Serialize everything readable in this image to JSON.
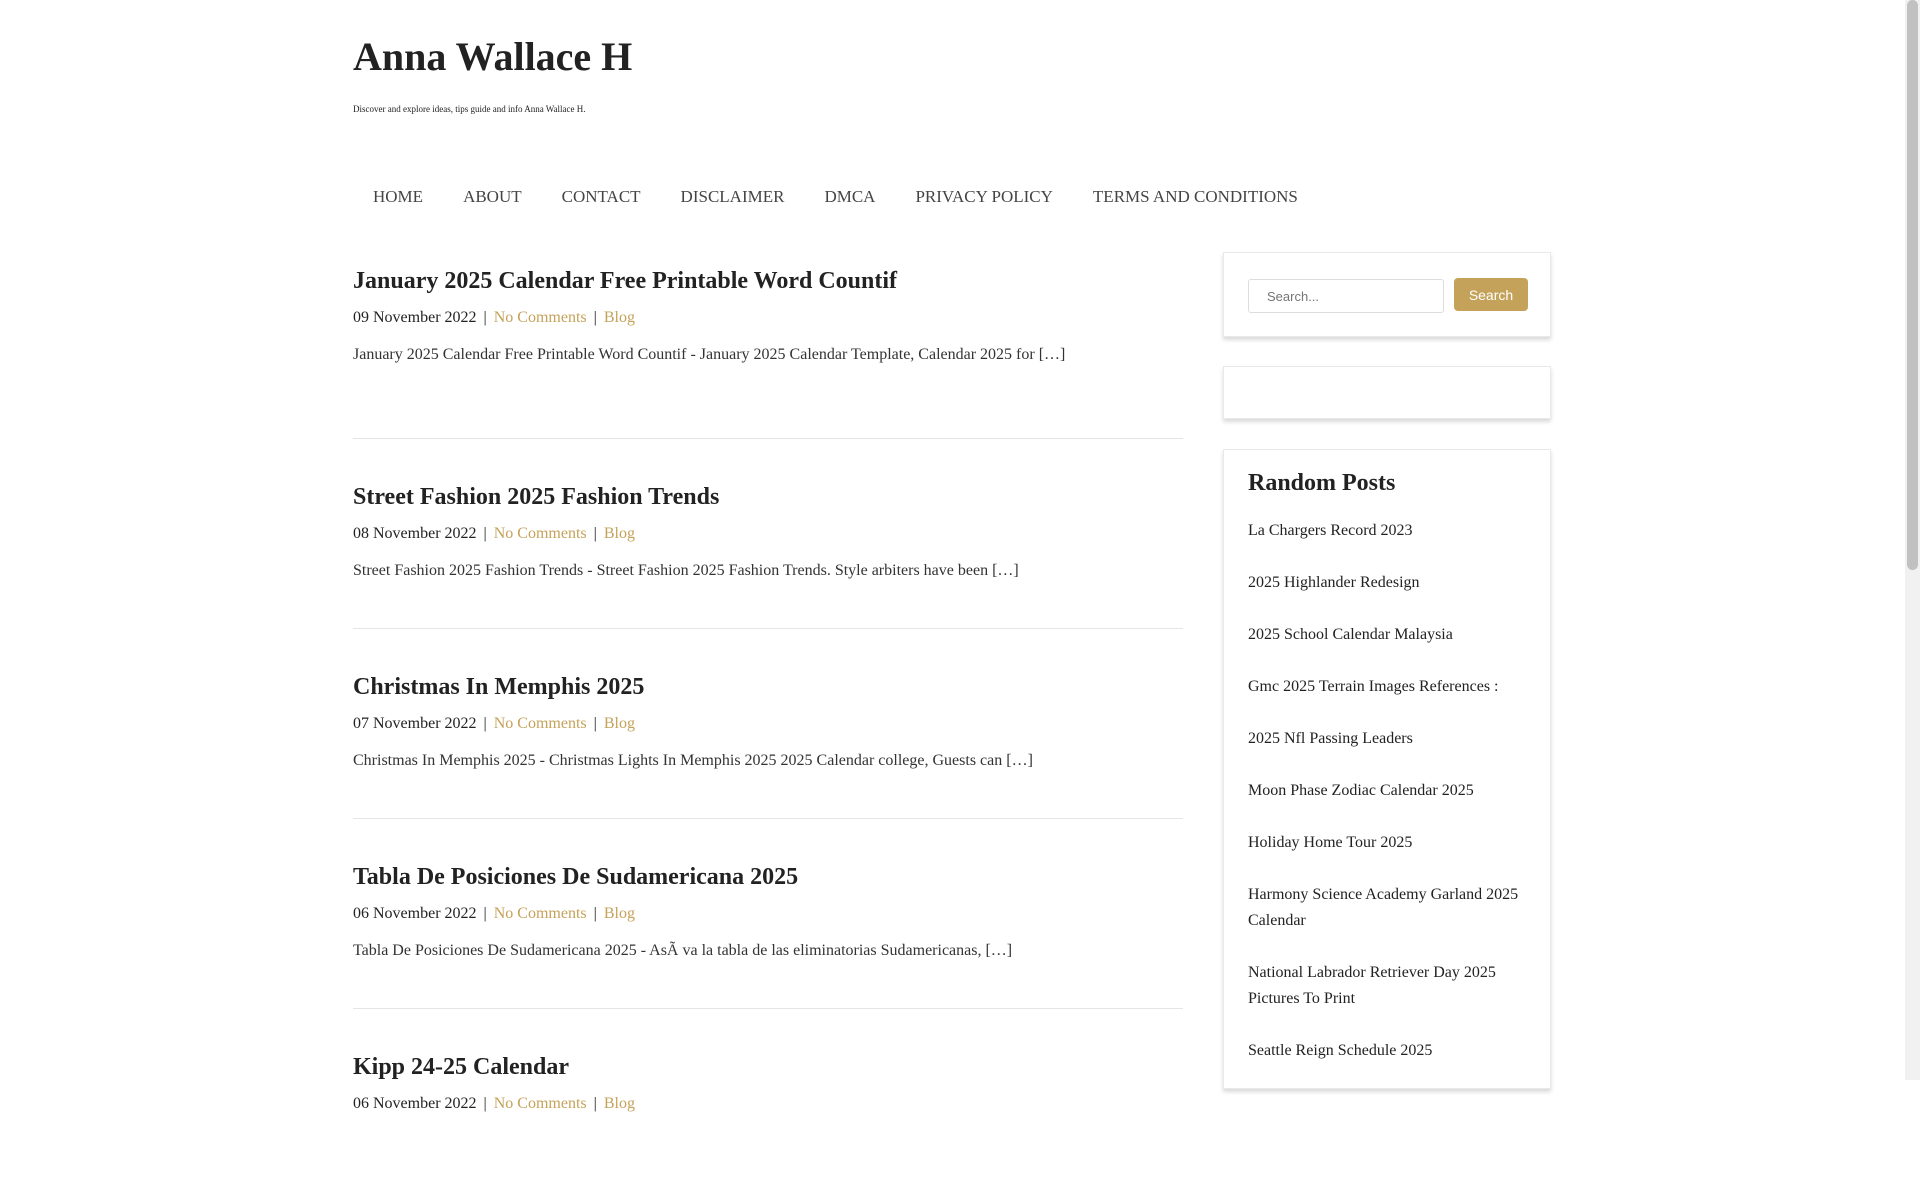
{
  "site": {
    "title": "Anna Wallace H",
    "tagline": "Discover and explore ideas, tips guide and info Anna Wallace H."
  },
  "nav": [
    "HOME",
    "ABOUT",
    "CONTACT",
    "DISCLAIMER",
    "DMCA",
    "PRIVACY POLICY",
    "TERMS AND CONDITIONS"
  ],
  "posts": [
    {
      "title": "January 2025 Calendar Free Printable Word Countif",
      "date": "09 November 2022",
      "comments": "No Comments",
      "category": "Blog",
      "excerpt": "January 2025 Calendar Free Printable Word Countif - January 2025 Calendar Template, Calendar 2025 for […]"
    },
    {
      "title": "Street Fashion 2025 Fashion Trends",
      "date": "08 November 2022",
      "comments": "No Comments",
      "category": "Blog",
      "excerpt": "Street Fashion 2025 Fashion Trends - Street Fashion 2025 Fashion Trends. Style arbiters have been […]"
    },
    {
      "title": "Christmas In Memphis 2025",
      "date": "07 November 2022",
      "comments": "No Comments",
      "category": "Blog",
      "excerpt": "Christmas In Memphis 2025 - Christmas Lights In Memphis 2025 2025 Calendar college, Guests can […]"
    },
    {
      "title": "Tabla De Posiciones De Sudamericana 2025",
      "date": "06 November 2022",
      "comments": "No Comments",
      "category": "Blog",
      "excerpt": "Tabla De Posiciones De Sudamericana 2025 - AsÃ va la tabla de las eliminatorias Sudamericanas, […]"
    },
    {
      "title": "Kipp 24-25 Calendar",
      "date": "06 November 2022",
      "comments": "No Comments",
      "category": "Blog",
      "excerpt": ""
    }
  ],
  "search": {
    "placeholder": "Search...",
    "button": "Search"
  },
  "random_posts": {
    "heading": "Random Posts",
    "items": [
      "La Chargers Record 2023",
      "2025 Highlander Redesign",
      "2025 School Calendar Malaysia",
      "Gmc 2025 Terrain Images References :",
      "2025 Nfl Passing Leaders",
      "Moon Phase Zodiac Calendar 2025",
      "Holiday Home Tour 2025",
      "Harmony Science Academy Garland 2025 Calendar",
      "National Labrador Retriever Day 2025 Pictures To Print",
      "Seattle Reign Schedule 2025"
    ]
  },
  "colors": {
    "accent": "#c5a25a",
    "text": "#222222",
    "border": "#e5e5e5"
  }
}
